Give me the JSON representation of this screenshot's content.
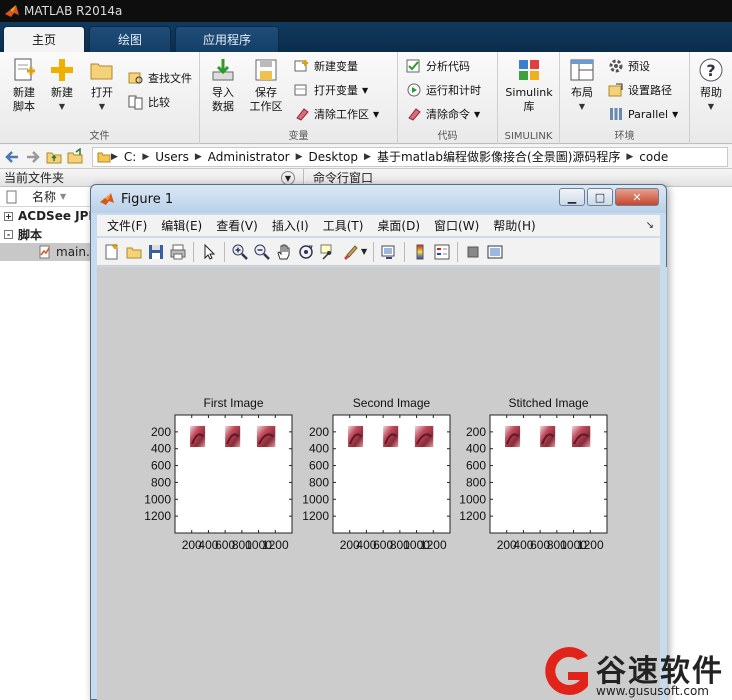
{
  "app": {
    "window_title": "MATLAB R2014a",
    "tabs": [
      {
        "label": "主页",
        "active": true
      },
      {
        "label": "绘图",
        "active": false
      },
      {
        "label": "应用程序",
        "active": false
      }
    ]
  },
  "ribbon": {
    "groups": {
      "file": "文件",
      "variable": "变量",
      "code": "代码",
      "simulink": "SIMULINK",
      "environment": "环境"
    },
    "buttons": {
      "new_script_1": "新建",
      "new_script_2": "脚本",
      "new": "新建",
      "open": "打开",
      "find_files": "查找文件",
      "compare": "比较",
      "import_1": "导入",
      "import_2": "数据",
      "save_ws_1": "保存",
      "save_ws_2": "工作区",
      "new_var": "新建变量",
      "open_var": "打开变量",
      "clear_ws": "清除工作区",
      "analyze_code": "分析代码",
      "run_time": "运行和计时",
      "clear_cmds": "清除命令",
      "simulink_1": "Simulink",
      "simulink_2": "库",
      "layout": "布局",
      "preferences": "预设",
      "set_path": "设置路径",
      "parallel": "Parallel",
      "help": "帮助"
    }
  },
  "address": {
    "crumbs": [
      "C:",
      "Users",
      "Administrator",
      "Desktop",
      "基于matlab编程做影像接合(全景圖)源码程序",
      "code"
    ]
  },
  "left_panel": {
    "title": "当前文件夹",
    "column_name": "名称",
    "items": [
      {
        "label": "ACDSee JPE",
        "bold": true,
        "expand": "+"
      },
      {
        "label": "脚本",
        "bold": true,
        "expand": "-"
      },
      {
        "label": "main.r",
        "bold": false,
        "selected": true
      }
    ]
  },
  "command_window": {
    "title": "命令行窗口"
  },
  "figure": {
    "title": "Figure 1",
    "menu": [
      "文件(F)",
      "编辑(E)",
      "查看(V)",
      "插入(I)",
      "工具(T)",
      "桌面(D)",
      "窗口(W)",
      "帮助(H)"
    ],
    "toolbar_icons": [
      "new-figure-icon",
      "open-file-icon",
      "save-icon",
      "print-icon",
      "select-arrow-icon",
      "zoom-in-icon",
      "zoom-out-icon",
      "pan-hand-icon",
      "rotate-3d-icon",
      "data-cursor-icon",
      "brush-icon",
      "link-plot-icon",
      "colorbar-icon",
      "legend-icon",
      "hide-plot-tools-icon",
      "show-plot-tools-icon"
    ]
  },
  "chart_data": [
    {
      "type": "image",
      "title": "First Image",
      "yticks": [
        200,
        400,
        600,
        800,
        1000,
        1200
      ],
      "xticks": [
        200,
        400,
        600,
        800,
        1000,
        1200
      ],
      "xtick_labels": [
        "200",
        "400",
        "600",
        "800",
        "1000",
        "1200"
      ],
      "xlim": [
        0,
        1400
      ],
      "ylim": [
        0,
        1400
      ],
      "thumbnails_x": [
        [
          180,
          360
        ],
        [
          600,
          780
        ],
        [
          980,
          1200
        ]
      ],
      "thumbnails_y": [
        130,
        380
      ]
    },
    {
      "type": "image",
      "title": "Second Image",
      "yticks": [
        200,
        400,
        600,
        800,
        1000,
        1200
      ],
      "xticks": [
        200,
        400,
        600,
        800,
        1000,
        1200
      ],
      "xtick_labels": [
        "200",
        "400",
        "600",
        "800",
        "1000",
        "1200"
      ],
      "xlim": [
        0,
        1400
      ],
      "ylim": [
        0,
        1400
      ],
      "thumbnails_x": [
        [
          180,
          360
        ],
        [
          600,
          780
        ],
        [
          980,
          1200
        ]
      ],
      "thumbnails_y": [
        130,
        380
      ]
    },
    {
      "type": "image",
      "title": "Stitched Image",
      "yticks": [
        200,
        400,
        600,
        800,
        1000,
        1200
      ],
      "xticks": [
        200,
        400,
        600,
        800,
        1000,
        1200
      ],
      "xtick_labels": [
        "200",
        "400",
        "600",
        "800",
        "1000",
        "1200"
      ],
      "xlim": [
        0,
        1400
      ],
      "ylim": [
        0,
        1400
      ],
      "thumbnails_x": [
        [
          180,
          360
        ],
        [
          600,
          780
        ],
        [
          980,
          1200
        ]
      ],
      "thumbnails_y": [
        130,
        380
      ]
    }
  ],
  "watermark": {
    "name": "谷速软件",
    "url": "www.gususoft.com"
  },
  "colors": {
    "titlebar": "#0e0e0e",
    "ribbon_tabs": "#113a5e",
    "figure_bg": "#cccccc",
    "watermark_red": "#e2231a"
  }
}
